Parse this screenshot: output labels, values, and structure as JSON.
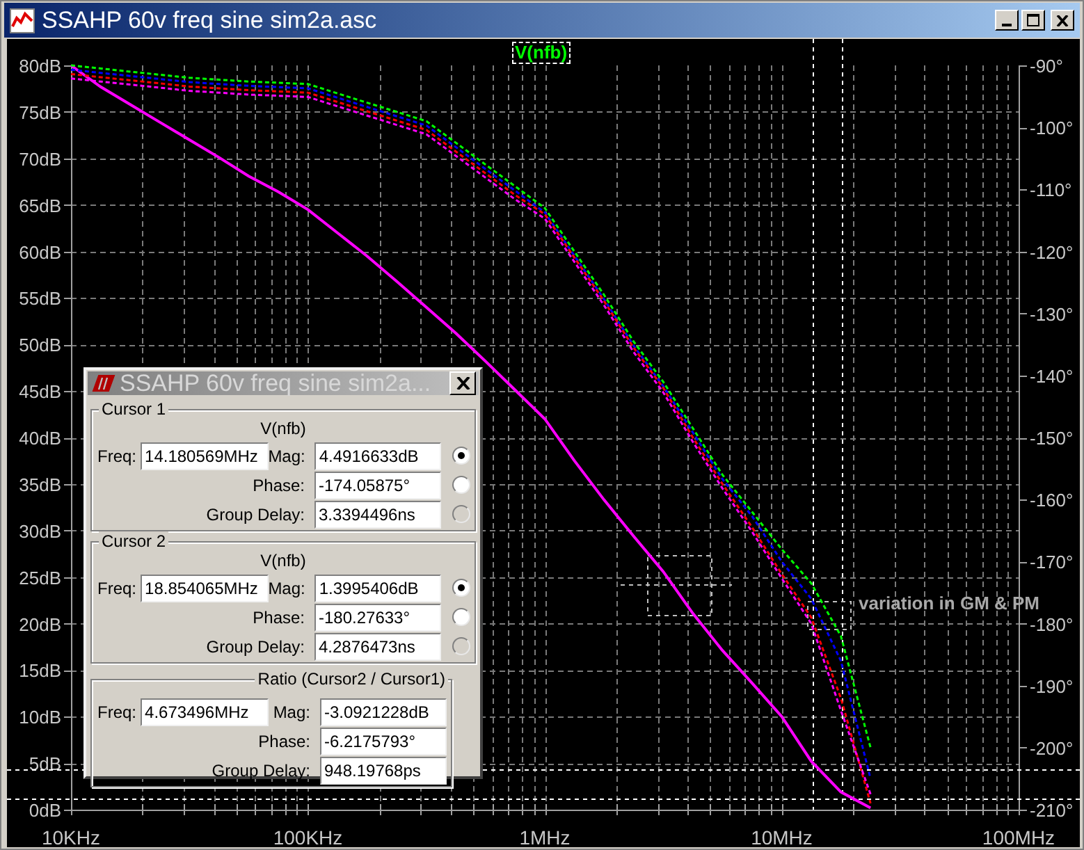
{
  "window": {
    "title": "SSAHP 60v freq sine sim2a.asc"
  },
  "plot": {
    "chart_data": {
      "type": "line",
      "title": "V(nfb)",
      "grid": true,
      "ylim": [
        0,
        80
      ],
      "y2lim": [
        -210,
        -90
      ],
      "categories": [
        "10KHz",
        null,
        null,
        null,
        null,
        null,
        null,
        null,
        "100KHz",
        null,
        null,
        null,
        null,
        null,
        null,
        null,
        "1MHz",
        null,
        null,
        null,
        null,
        null,
        null,
        null,
        "10MHz",
        null,
        null,
        null,
        null,
        null,
        null,
        null,
        "100MHz"
      ],
      "series": [
        {
          "color": "#ff00ff",
          "values": [
            80,
            77.7,
            75.8,
            73.9,
            72,
            70.1,
            68.1,
            66.4,
            64.5,
            62,
            59.5,
            56.8,
            54,
            51.2,
            48.2,
            45.1,
            42,
            37.5,
            33.3,
            29.4,
            25.6,
            21.1,
            17.1,
            13.6,
            10,
            5.2,
            1.9,
            0.2,
            null,
            null,
            null,
            null,
            null
          ]
        },
        {
          "axis": "y2",
          "line_style": "dotted",
          "color": "#00ff00",
          "values": [
            -90,
            -90.5,
            -91,
            -91.5,
            -92,
            -92.3,
            -92.6,
            -92.8,
            -93,
            -94.5,
            -96,
            -97.5,
            -99,
            -102.5,
            -106,
            -109.5,
            -113,
            -120,
            -127,
            -134.5,
            -141,
            -148.5,
            -156,
            -162,
            -168,
            -173.5,
            -182,
            -200,
            null,
            null,
            null,
            null,
            null
          ]
        },
        {
          "axis": "y2",
          "line_style": "dotted",
          "color": "#0000ff",
          "values": [
            -90.7,
            -91.2,
            -91.7,
            -92.2,
            -92.7,
            -93,
            -93.3,
            -93.5,
            -93.7,
            -95.2,
            -96.7,
            -98.2,
            -99.7,
            -103.2,
            -106.7,
            -110.2,
            -113.7,
            -120.7,
            -127.7,
            -135.2,
            -141.7,
            -149.2,
            -156.7,
            -162.7,
            -170,
            -176,
            -186,
            -205,
            null,
            null,
            null,
            null,
            null
          ]
        },
        {
          "axis": "y2",
          "line_style": "dotted",
          "color": "#ff0000",
          "values": [
            -91.4,
            -91.9,
            -92.4,
            -92.9,
            -93.4,
            -93.7,
            -94,
            -94.2,
            -94.4,
            -95.9,
            -97.4,
            -98.9,
            -100.4,
            -103.9,
            -107.4,
            -110.9,
            -114,
            -121,
            -128,
            -135.5,
            -142,
            -150,
            -157.5,
            -164.5,
            -172,
            -179,
            -192,
            -209,
            null,
            null,
            null,
            null,
            null
          ]
        },
        {
          "axis": "y2",
          "line_style": "dotted",
          "color": "#ff00ff",
          "values": [
            -92.1,
            -92.6,
            -93.1,
            -93.6,
            -94.1,
            -94.4,
            -94.7,
            -94.9,
            -95.1,
            -96.6,
            -98.1,
            -99.6,
            -101.1,
            -104.6,
            -108.1,
            -111.6,
            -114.7,
            -121.7,
            -128.7,
            -136.2,
            -142.7,
            -150.7,
            -158.2,
            -165.2,
            -172.7,
            -180,
            -194,
            -207.5,
            null,
            null,
            null,
            null,
            null
          ]
        }
      ],
      "yticks": [
        {
          "value": 80,
          "label": "80dB"
        },
        {
          "value": 75,
          "label": "75dB"
        },
        {
          "value": 70,
          "label": "70dB"
        },
        {
          "value": 65,
          "label": "65dB"
        },
        {
          "value": 60,
          "label": "60dB"
        },
        {
          "value": 55,
          "label": "55dB"
        },
        {
          "value": 50,
          "label": "50dB"
        },
        {
          "value": 45,
          "label": "45dB"
        },
        {
          "value": 40,
          "label": "40dB"
        },
        {
          "value": 35,
          "label": "35dB"
        },
        {
          "value": 30,
          "label": "30dB"
        },
        {
          "value": 25,
          "label": "25dB"
        },
        {
          "value": 20,
          "label": "20dB"
        },
        {
          "value": 15,
          "label": "15dB"
        },
        {
          "value": 10,
          "label": "10dB"
        },
        {
          "value": 5,
          "label": "5dB"
        },
        {
          "value": 0,
          "label": "0dB"
        }
      ],
      "y2ticks": [
        {
          "value": -90,
          "label": "-90°"
        },
        {
          "value": -100,
          "label": "-100°"
        },
        {
          "value": -110,
          "label": "-110°"
        },
        {
          "value": -120,
          "label": "-120°"
        },
        {
          "value": -130,
          "label": "-130°"
        },
        {
          "value": -140,
          "label": "-140°"
        },
        {
          "value": -150,
          "label": "-150°"
        },
        {
          "value": -160,
          "label": "-160°"
        },
        {
          "value": -170,
          "label": "-170°"
        },
        {
          "value": -180,
          "label": "-180°"
        },
        {
          "value": -190,
          "label": "-190°"
        },
        {
          "value": -200,
          "label": "-200°"
        },
        {
          "value": -210,
          "label": "-210°"
        }
      ],
      "annotations": [
        {
          "text": "variation in GM & PM"
        }
      ]
    }
  },
  "cursor_dialog": {
    "title": "SSAHP 60v freq sine sim2a...",
    "groups": [
      {
        "kind": "cursor",
        "legend": "Cursor 1",
        "trace": "V(nfb)",
        "freq_label": "Freq:",
        "freq": "14.180569MHz",
        "fields": [
          {
            "label": "Mag:",
            "value": "4.4916633dB",
            "selected": true,
            "disabled": false
          },
          {
            "label": "Phase:",
            "value": "-174.05875°",
            "selected": false,
            "disabled": false
          },
          {
            "label": "Group Delay:",
            "value": "3.3394496ns",
            "selected": false,
            "disabled": true
          }
        ]
      },
      {
        "kind": "cursor",
        "legend": "Cursor 2",
        "trace": "V(nfb)",
        "freq_label": "Freq:",
        "freq": "18.854065MHz",
        "fields": [
          {
            "label": "Mag:",
            "value": "1.3995406dB",
            "selected": true,
            "disabled": false
          },
          {
            "label": "Phase:",
            "value": "-180.27633°",
            "selected": false,
            "disabled": false
          },
          {
            "label": "Group Delay:",
            "value": "4.2876473ns",
            "selected": false,
            "disabled": true
          }
        ]
      },
      {
        "kind": "ratio",
        "legend": "Ratio (Cursor2 / Cursor1)",
        "freq_label": "Freq:",
        "freq": "4.673496MHz",
        "fields": [
          {
            "label": "Mag:",
            "value": "-3.0921228dB"
          },
          {
            "label": "Phase:",
            "value": "-6.2175793°"
          },
          {
            "label": "Group Delay:",
            "value": "948.19768ps"
          }
        ]
      }
    ]
  }
}
